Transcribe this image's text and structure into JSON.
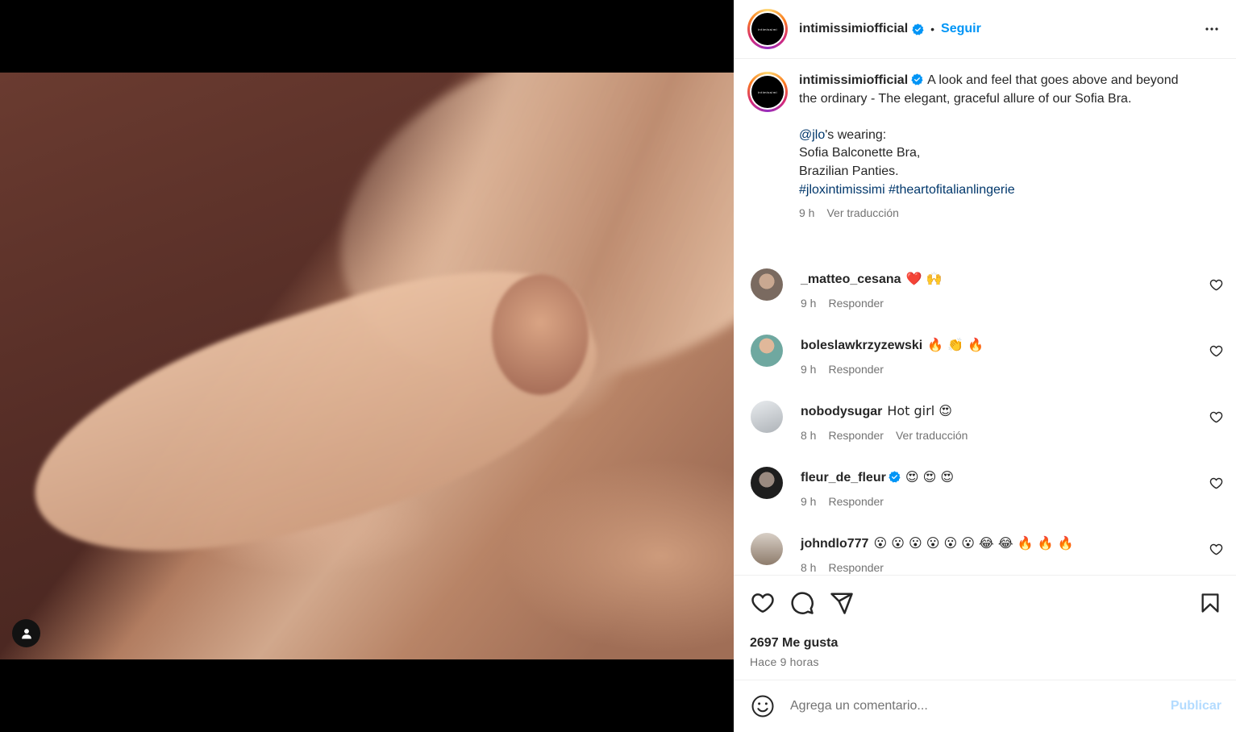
{
  "post": {
    "author": {
      "username": "intimissimiofficial",
      "avatar_text": "intimissimi",
      "verified": true
    },
    "follow_label": "Seguir",
    "separator": "•",
    "caption": {
      "text_line1": "A look and feel that goes above and beyond the ordinary - The elegant, graceful allure of our Sofia Bra.",
      "mention": "@jlo",
      "mention_suffix": "'s wearing:",
      "line_items": "Sofia Balconette Bra,\nBrazilian Panties.",
      "hashtag1": "#jloxintimissimi",
      "hashtag2": "#theartofitalianlingerie",
      "time": "9 h",
      "translate": "Ver traducción"
    },
    "comments": [
      {
        "username": "_matteo_cesana",
        "verified": false,
        "text": "❤️ 🙌",
        "time": "9 h",
        "reply": "Responder",
        "translate": "",
        "avatar_color": "#7a6a60"
      },
      {
        "username": "boleslawkrzyzewski",
        "verified": false,
        "text": "🔥 👏 🔥",
        "time": "9 h",
        "reply": "Responder",
        "translate": "",
        "avatar_color": "#6fa8a0"
      },
      {
        "username": "nobodysugar",
        "verified": false,
        "text": "Hot girl 😍",
        "time": "8 h",
        "reply": "Responder",
        "translate": "Ver traducción",
        "avatar_color": "#c9ccd0"
      },
      {
        "username": "fleur_de_fleur",
        "verified": true,
        "text": "😍 😍 😍",
        "time": "9 h",
        "reply": "Responder",
        "translate": "",
        "avatar_color": "#2a2a2a"
      },
      {
        "username": "johndlo777",
        "verified": false,
        "text": "😮 😮 😮 😮 😮 😮 😂 😂 🔥 🔥 🔥",
        "time": "8 h",
        "reply": "Responder",
        "translate": "",
        "avatar_color": "#8e7c6c"
      }
    ],
    "likes": "2697 Me gusta",
    "posted": "Hace 9 horas",
    "comment_placeholder": "Agrega un comentario...",
    "publish_label": "Publicar"
  },
  "icons": {
    "more": "more-options-icon",
    "like": "heart-icon",
    "comment": "comment-icon",
    "share": "share-icon",
    "save": "bookmark-icon",
    "emoji": "emoji-icon",
    "user_tag": "user-tag-icon"
  },
  "colors": {
    "accent": "#0095f6",
    "link": "#00376b",
    "muted": "#737373",
    "publish_disabled": "#b3dbff",
    "verified": "#0095f6"
  }
}
